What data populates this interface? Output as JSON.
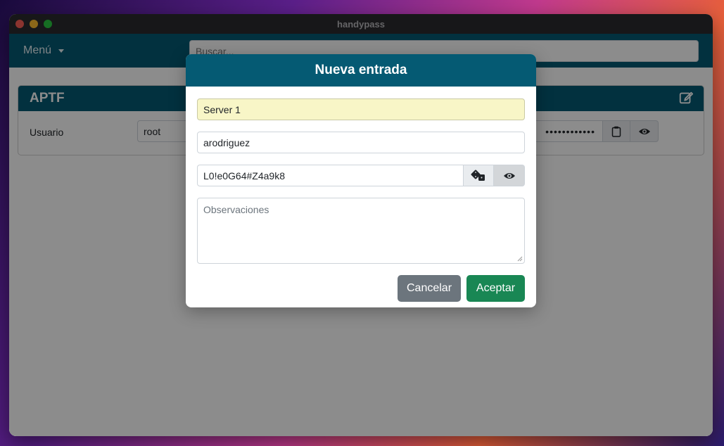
{
  "window": {
    "title": "handypass"
  },
  "navbar": {
    "menu_label": "Menú",
    "search_placeholder": "Buscar..."
  },
  "card": {
    "title": "APTF",
    "user_label": "Usuario",
    "user_value": "root",
    "password_masked": "••••••••••••"
  },
  "modal": {
    "title": "Nueva entrada",
    "entry_title_value": "Server 1",
    "username_value": "arodriguez",
    "password_value": "L0!e0G64#Z4a9k8",
    "notes_placeholder": "Observaciones",
    "cancel_label": "Cancelar",
    "accept_label": "Aceptar"
  },
  "colors": {
    "brand": "#055a73",
    "accept": "#198754",
    "cancel": "#6c757d"
  },
  "icons": [
    "edit-icon",
    "clipboard-icon",
    "eye-icon",
    "dice-icon"
  ]
}
